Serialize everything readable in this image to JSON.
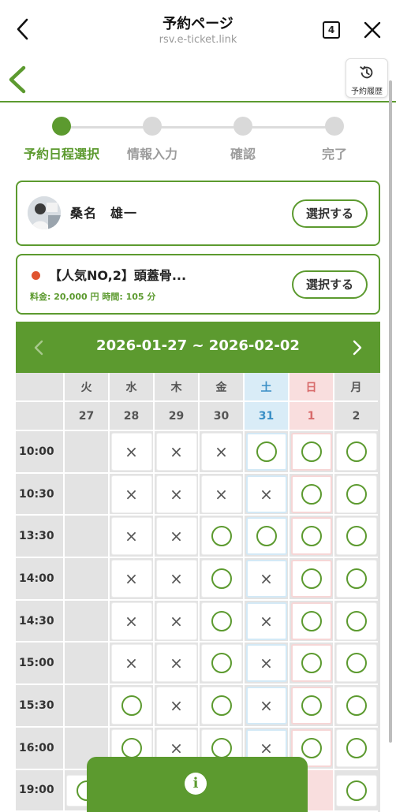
{
  "browser": {
    "title": "予約ページ",
    "url": "rsv.e-ticket.link",
    "tab_count": "4",
    "icons": {
      "back": "chevron-left-icon",
      "close": "close-icon",
      "tabs": "tab-count-icon"
    }
  },
  "nav": {
    "history_label": "予約履歴",
    "accent_color": "#5c9a2f"
  },
  "steps": [
    {
      "label": "予約日程選択",
      "active": true
    },
    {
      "label": "情報入力",
      "active": false
    },
    {
      "label": "確認",
      "active": false
    },
    {
      "label": "完了",
      "active": false
    }
  ],
  "staff": {
    "name": "桑名　雄一",
    "select_label": "選択する"
  },
  "menu": {
    "name": "【人気NO,2】頭蓋骨...",
    "price_label": "料金: 20,000 円",
    "time_label": "時間: 105 分",
    "select_label": "選択する"
  },
  "calendar": {
    "range": "2026-01-27 ~ 2026-02-02",
    "weekdays": [
      "火",
      "水",
      "木",
      "金",
      "土",
      "日",
      "月"
    ],
    "dates": [
      "27",
      "28",
      "29",
      "30",
      "31",
      "1",
      "2"
    ],
    "times": [
      "10:00",
      "10:30",
      "13:30",
      "14:00",
      "14:30",
      "15:00",
      "15:30",
      "16:00",
      "19:00"
    ],
    "slots": [
      [
        "",
        "×",
        "×",
        "×",
        "○",
        "○",
        "○"
      ],
      [
        "",
        "×",
        "×",
        "×",
        "×",
        "○",
        "○"
      ],
      [
        "",
        "×",
        "×",
        "○",
        "○",
        "○",
        "○"
      ],
      [
        "",
        "×",
        "×",
        "○",
        "×",
        "○",
        "○"
      ],
      [
        "",
        "×",
        "×",
        "○",
        "×",
        "○",
        "○"
      ],
      [
        "",
        "×",
        "×",
        "○",
        "×",
        "○",
        "○"
      ],
      [
        "",
        "○",
        "×",
        "○",
        "×",
        "○",
        "○"
      ],
      [
        "",
        "○",
        "×",
        "○",
        "×",
        "○",
        "○"
      ],
      [
        "○",
        "",
        "",
        "",
        "",
        "",
        "○"
      ]
    ]
  }
}
